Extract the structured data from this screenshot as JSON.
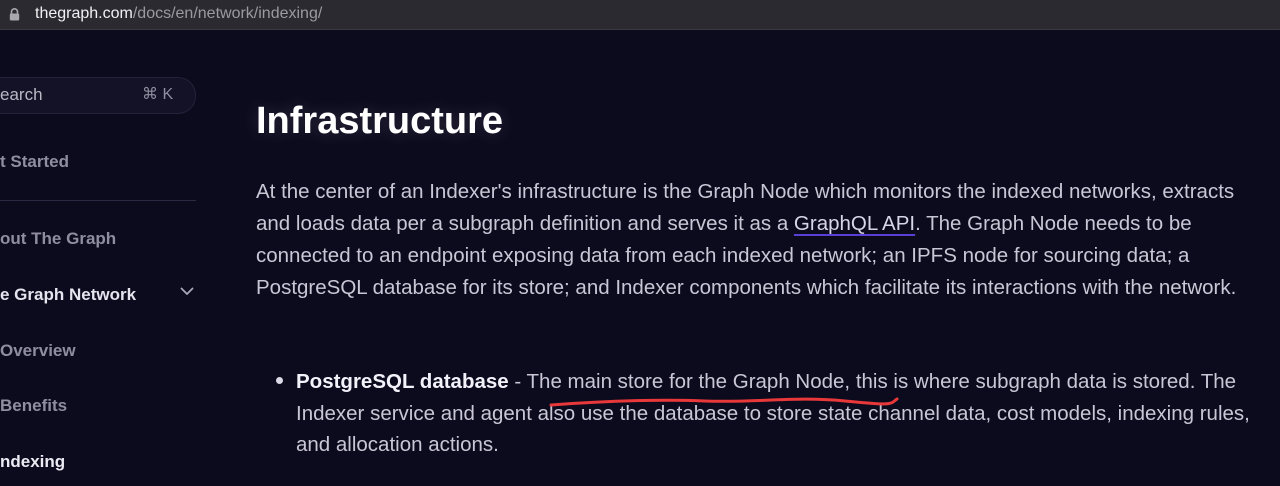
{
  "browser": {
    "url_host": "thegraph.com",
    "url_path": "/docs/en/network/indexing/"
  },
  "sidebar": {
    "search_placeholder": "earch",
    "search_shortcut": "⌘ K",
    "items": [
      {
        "label": "t Started"
      },
      {
        "label": "out The Graph"
      },
      {
        "label": "e Graph Network"
      },
      {
        "label": "Overview"
      },
      {
        "label": "Benefits"
      },
      {
        "label": "ndexing"
      }
    ]
  },
  "main": {
    "heading": "Infrastructure",
    "para_part1": "At the center of an Indexer's infrastructure is the Graph Node which monitors the indexed networks, extracts and loads data per a subgraph definition and serves it as a ",
    "para_link": "GraphQL API",
    "para_part2": ". The Graph Node needs to be connected to an endpoint exposing data from each indexed network; an IPFS node for sourcing data; a PostgreSQL database for its store; and Indexer components which facilitate its interactions with the network.",
    "bullet_title": "PostgreSQL database",
    "bullet_text": " - The main store for the Graph Node, this is where subgraph data is stored. The Indexer service and agent also use the database to store state channel data, cost models, indexing rules, and allocation actions."
  },
  "colors": {
    "background": "#0c0a1d",
    "link_underline": "#5a3fd6",
    "annotation_red": "#e8383a"
  }
}
